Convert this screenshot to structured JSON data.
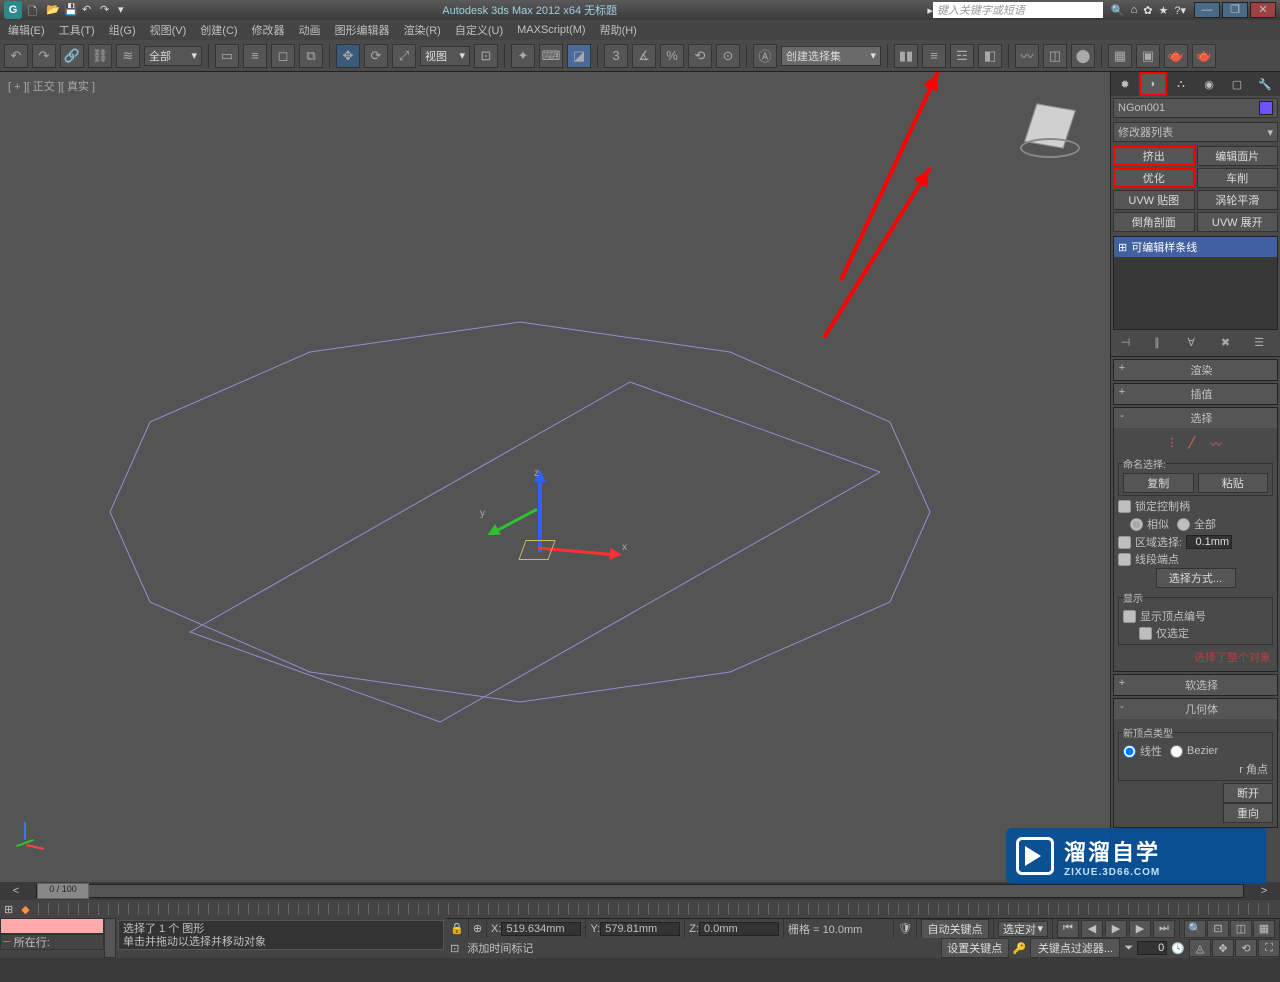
{
  "title": "Autodesk 3ds Max 2012 x64   无标题",
  "search_placeholder": "键入关键字或短语",
  "menus": [
    "编辑(E)",
    "工具(T)",
    "组(G)",
    "视图(V)",
    "创建(C)",
    "修改器",
    "动画",
    "图形编辑器",
    "渲染(R)",
    "自定义(U)",
    "MAXScript(M)",
    "帮助(H)"
  ],
  "toolbar": {
    "filter": "全部",
    "coord": "视图",
    "selset": "创建选择集"
  },
  "viewport": {
    "label": "[ + ][ 正交 ][ 真实 ]",
    "axes": {
      "x": "x",
      "y": "y",
      "z": "z"
    }
  },
  "object_name": "NGon001",
  "modifier_list_label": "修改器列表",
  "modifier_buttons": [
    [
      "挤出",
      "编辑面片"
    ],
    [
      "优化",
      "车削"
    ],
    [
      "UVW 贴图",
      "涡轮平滑"
    ],
    [
      "倒角剖面",
      "UVW 展开"
    ]
  ],
  "mod_stack_item": "可编辑样条线",
  "rollouts": {
    "render": "渲染",
    "interp": "插值",
    "selection": "选择",
    "softsel": "软选择",
    "geometry": "几何体"
  },
  "selection": {
    "named_label": "命名选择:",
    "copy": "复制",
    "paste": "粘贴",
    "lock_handles": "锁定控制柄",
    "similar": "相似",
    "all": "全部",
    "area_select": "区域选择:",
    "area_value": "0.1mm",
    "seg_end": "线段端点",
    "select_by": "选择方式...",
    "display": "显示",
    "show_vn": "显示顶点编号",
    "only_sel": "仅选定",
    "status": "选择了整个对象"
  },
  "geometry": {
    "new_vtype": "新顶点类型",
    "linear": "线性",
    "bezier": "Bezier",
    "corner": "r 角点",
    "break": "断开",
    "redirect": "重向"
  },
  "timeline": {
    "handle": "0 / 100"
  },
  "status": {
    "selected": "选择了 1 个 图形",
    "hint": "单击并拖动以选择并移动对象",
    "x": "519.634mm",
    "y": "579.81mm",
    "z": "0.0mm",
    "grid": "栅格 = 10.0mm",
    "autokey": "自动关键点",
    "selected_pair": "选定对",
    "setkey": "设置关键点",
    "keyfilter": "关键点过滤器...",
    "addtime": "添加时间标记",
    "location": "所在行:",
    "frame": "0"
  },
  "watermark": {
    "big": "溜溜自学",
    "small": "ZIXUE.3D66.COM"
  }
}
